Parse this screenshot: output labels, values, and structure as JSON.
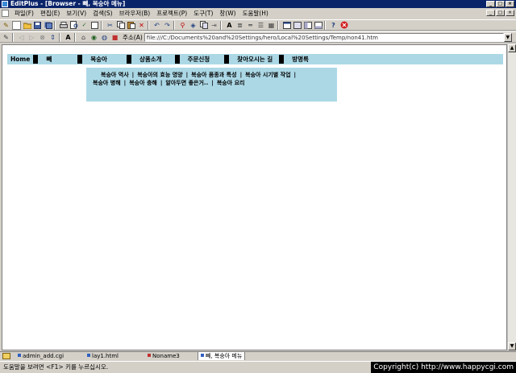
{
  "window": {
    "title": "EditPlus - [Browser - 빼, 복숭아 메뉴]",
    "buttons": [
      "_",
      "□",
      "×"
    ]
  },
  "menubar": {
    "items": [
      "파일(F)",
      "편집(E)",
      "보기(V)",
      "검색(S)",
      "브라우저(B)",
      "프로젝트(P)",
      "도구(T)",
      "창(W)",
      "도움말(H)"
    ]
  },
  "addressbar": {
    "label": "주소(A)",
    "value": "file:///C:/Documents%20and%20Settings/hero/Local%20Settings/Temp/non41.htm"
  },
  "page": {
    "nav": {
      "home": "Home",
      "items": [
        "빼",
        "복숭아",
        "상품소개",
        "주문신청",
        "찾아오시는 길",
        "방명록"
      ]
    },
    "submenu": {
      "items": [
        "복숭아 역사",
        "복숭아의 효능 영양",
        "복숭아 품종과 특성",
        "복숭아 시기별 작업",
        "복숭아 병해",
        "복숭아 충해",
        "알아두면 좋은거..",
        "복숭아 요리"
      ],
      "separator": "|"
    }
  },
  "filetabs": [
    {
      "label": "admin_add.cgi",
      "color": "#3060c0"
    },
    {
      "label": "lay1.html",
      "color": "#3060c0"
    },
    {
      "label": "Noname3",
      "color": "#c03030"
    },
    {
      "label": "빼, 복숭아 메뉴",
      "color": "#3060c0",
      "active": true
    }
  ],
  "status": {
    "text": "도움말을 보려면 <F1> 키를 누르십시오.",
    "copyright": "Copyright(c) http://www.happycgi.com"
  }
}
